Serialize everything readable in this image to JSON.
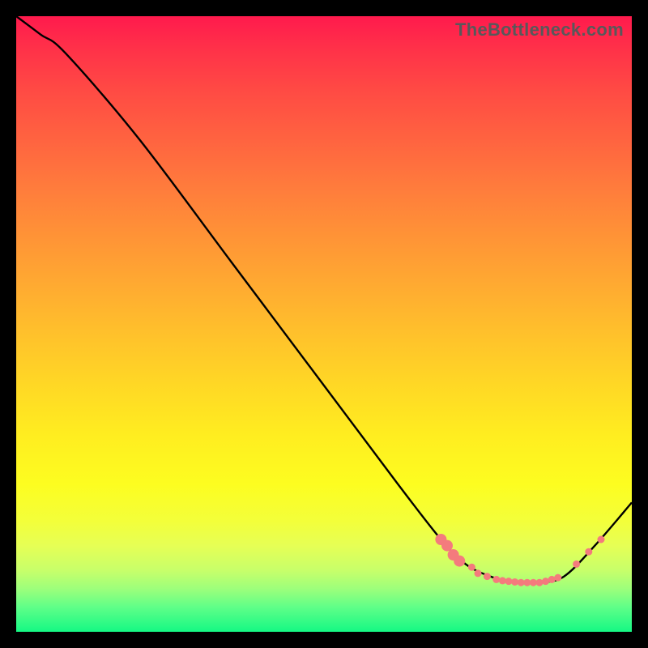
{
  "watermark": "TheBottleneck.com",
  "chart_data": {
    "type": "line",
    "title": "",
    "xlabel": "",
    "ylabel": "",
    "xlim": [
      0,
      100
    ],
    "ylim": [
      0,
      100
    ],
    "grid": false,
    "series": [
      {
        "name": "bottleneck-curve",
        "color": "#000000",
        "x": [
          0,
          4,
          8,
          20,
          35,
          50,
          62,
          69,
          73,
          77,
          81,
          85,
          89,
          94,
          100
        ],
        "y": [
          100,
          97,
          94,
          80,
          60,
          40,
          24,
          15,
          11,
          9,
          8,
          8,
          9,
          14,
          21
        ]
      }
    ],
    "markers": {
      "name": "optimal-range-markers",
      "color": "#f47b7d",
      "radius_large": 7,
      "radius_small": 4.5,
      "points": [
        {
          "x": 69,
          "y": 15,
          "r": "large"
        },
        {
          "x": 70,
          "y": 14,
          "r": "large"
        },
        {
          "x": 71,
          "y": 12.5,
          "r": "large"
        },
        {
          "x": 72,
          "y": 11.5,
          "r": "large"
        },
        {
          "x": 74,
          "y": 10.5,
          "r": "small"
        },
        {
          "x": 75,
          "y": 9.5,
          "r": "small"
        },
        {
          "x": 76.5,
          "y": 9,
          "r": "small"
        },
        {
          "x": 78,
          "y": 8.5,
          "r": "small"
        },
        {
          "x": 79,
          "y": 8.3,
          "r": "small"
        },
        {
          "x": 80,
          "y": 8.2,
          "r": "small"
        },
        {
          "x": 81,
          "y": 8.1,
          "r": "small"
        },
        {
          "x": 82,
          "y": 8,
          "r": "small"
        },
        {
          "x": 83,
          "y": 8,
          "r": "small"
        },
        {
          "x": 84,
          "y": 8,
          "r": "small"
        },
        {
          "x": 85,
          "y": 8,
          "r": "small"
        },
        {
          "x": 86,
          "y": 8.2,
          "r": "small"
        },
        {
          "x": 87,
          "y": 8.5,
          "r": "small"
        },
        {
          "x": 88,
          "y": 8.8,
          "r": "small"
        },
        {
          "x": 91,
          "y": 11,
          "r": "small"
        },
        {
          "x": 93,
          "y": 13,
          "r": "small"
        },
        {
          "x": 95,
          "y": 15,
          "r": "small"
        }
      ]
    }
  }
}
